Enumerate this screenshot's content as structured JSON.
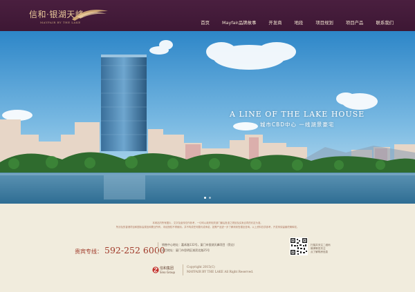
{
  "brand": {
    "logo_cn": "信和·银湖天峰",
    "logo_en": "MAYFAIR BY THE LAKE"
  },
  "nav": {
    "items": [
      {
        "label": "首页"
      },
      {
        "label": "Mayfair品牌故事"
      },
      {
        "label": "开发商"
      },
      {
        "label": "地段"
      },
      {
        "label": "项目规划"
      },
      {
        "label": "项目产品"
      },
      {
        "label": "联系我们"
      }
    ]
  },
  "hero": {
    "tagline_en": "A LINE OF THE LAKE HOUSE",
    "tagline_cn": "城市CBD中心  一线湖景豪宅",
    "slides_total": 2,
    "active_slide": 1
  },
  "footer": {
    "disclaimer_line1": "本网站内所有图片，文字及宣传仅作参考，一切均以政府相关部门最后批准之规划及买卖合同的约定为准。",
    "disclaimer_line2": "所涉及的香港项目和图标皆属信和置业所有，未经授权不得使用。并不构成任何要约或承诺，如需产品进一步了解请到售楼处咨询。以上资料仅供参考，开发商保留最终解释权。",
    "hotline_label": "贵宾专线：",
    "hotline_number": "592-252 6000",
    "address_line1": "销售中心地址：嘉禾路132号，厦门市银湖天峰项目（旁边）",
    "address_line2": "项目地址：厦门市思明区湖滨北路25号",
    "qr_line1": "扫描并关注二维码",
    "qr_line2": "微博等您关注",
    "qr_line3": "点了解购房信息",
    "group_cn": "信和集团",
    "group_en": "Sino Group",
    "copyright_line1": "Copyright 2015(C)",
    "copyright_line2": "MAYFAIR BY THE LAKE All Right Reserved."
  },
  "colors": {
    "header_bg": "#3d1734",
    "accent_gold": "#e9c99a",
    "hotline_red": "#a03a2a",
    "footer_bg": "#f1ecdd"
  }
}
